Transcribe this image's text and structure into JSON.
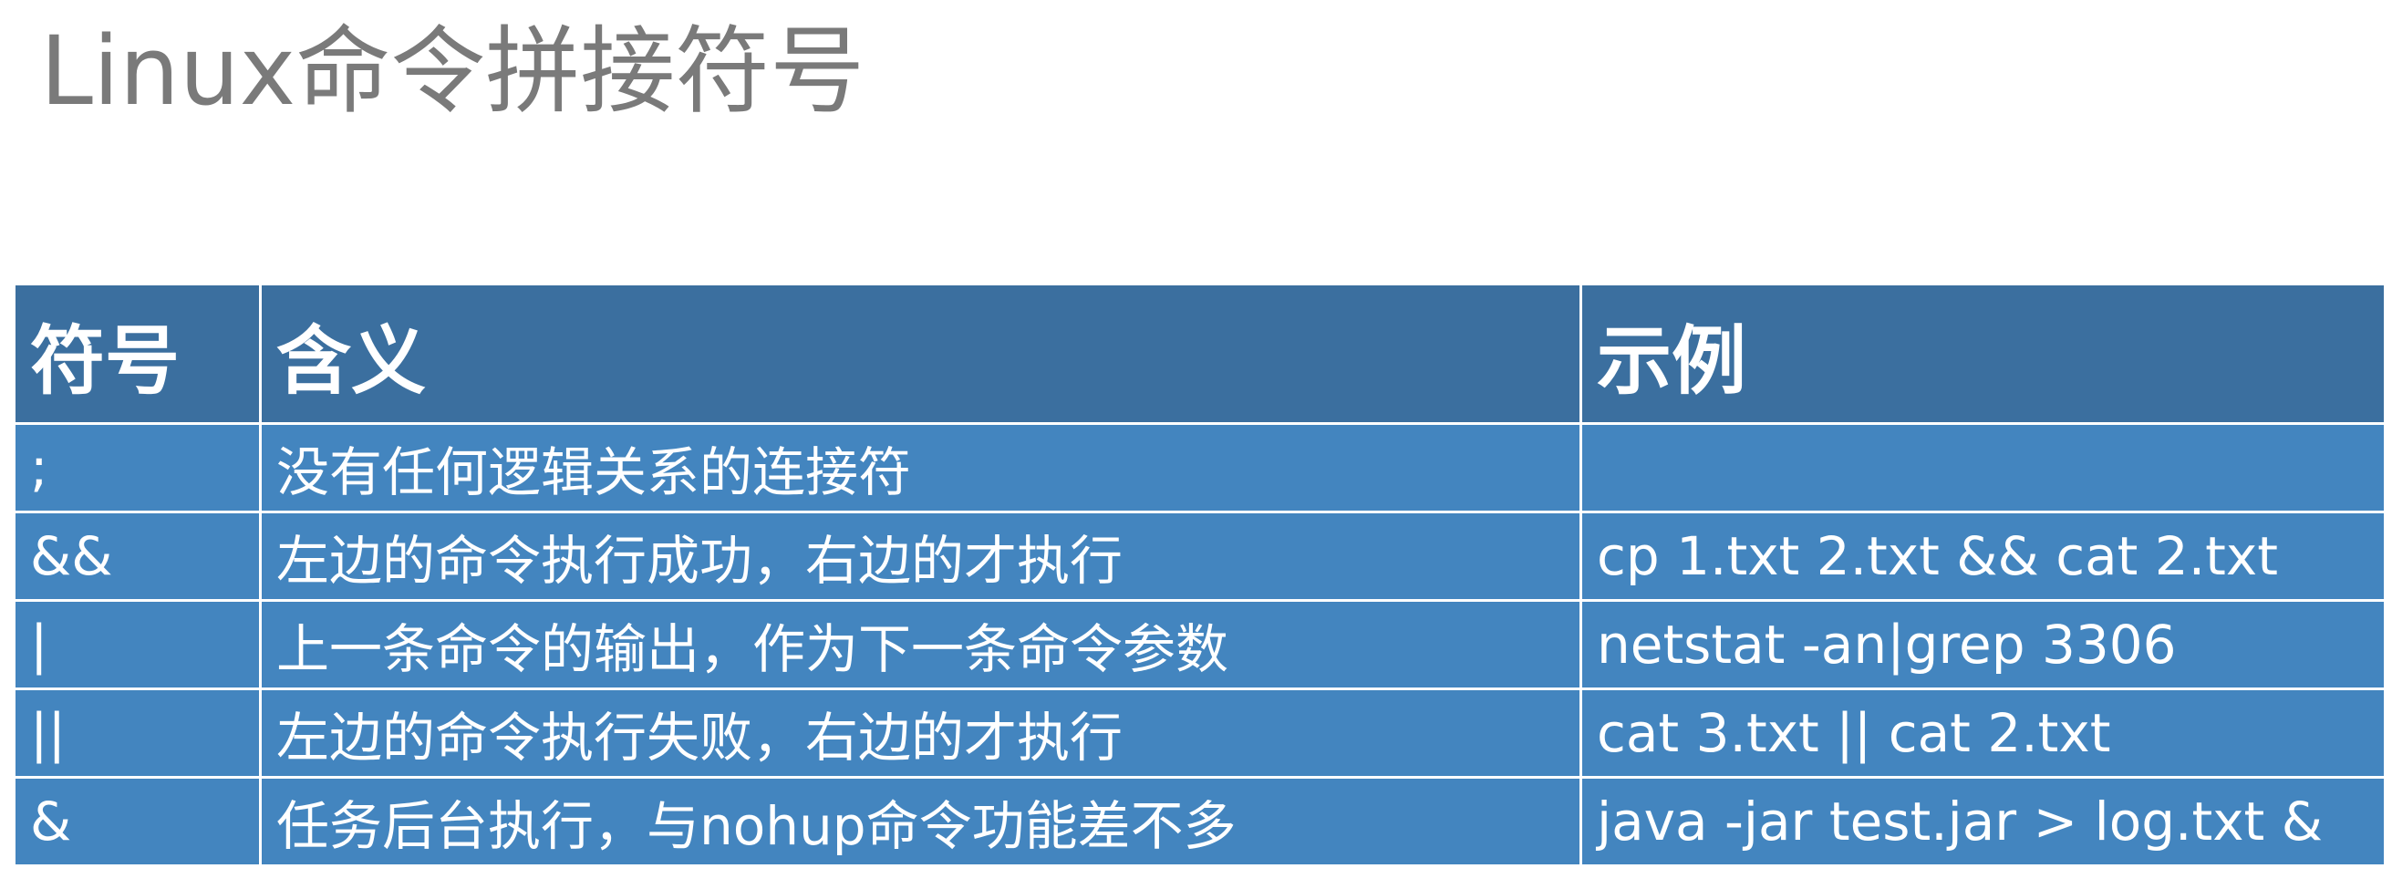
{
  "title": "Linux命令拼接符号",
  "table": {
    "headers": [
      "符号",
      "含义",
      "示例"
    ],
    "rows": [
      {
        "symbol": ";",
        "meaning": "没有任何逻辑关系的连接符",
        "example": ""
      },
      {
        "symbol": "&&",
        "meaning": "左边的命令执行成功，右边的才执行",
        "example": "cp 1.txt 2.txt && cat 2.txt"
      },
      {
        "symbol": "|",
        "meaning": "上一条命令的输出，作为下一条命令参数",
        "example": "netstat -an|grep 3306"
      },
      {
        "symbol": "||",
        "meaning": "左边的命令执行失败，右边的才执行",
        "example": "cat 3.txt || cat 2.txt"
      },
      {
        "symbol": "&",
        "meaning": "任务后台执行，与nohup命令功能差不多",
        "example": "java -jar test.jar > log.txt &"
      }
    ]
  },
  "colors": {
    "header_bg": "#3b6f9f",
    "row_bg": "#4385bf",
    "title_text": "#7a7a7a",
    "cell_text": "#ffffff"
  }
}
